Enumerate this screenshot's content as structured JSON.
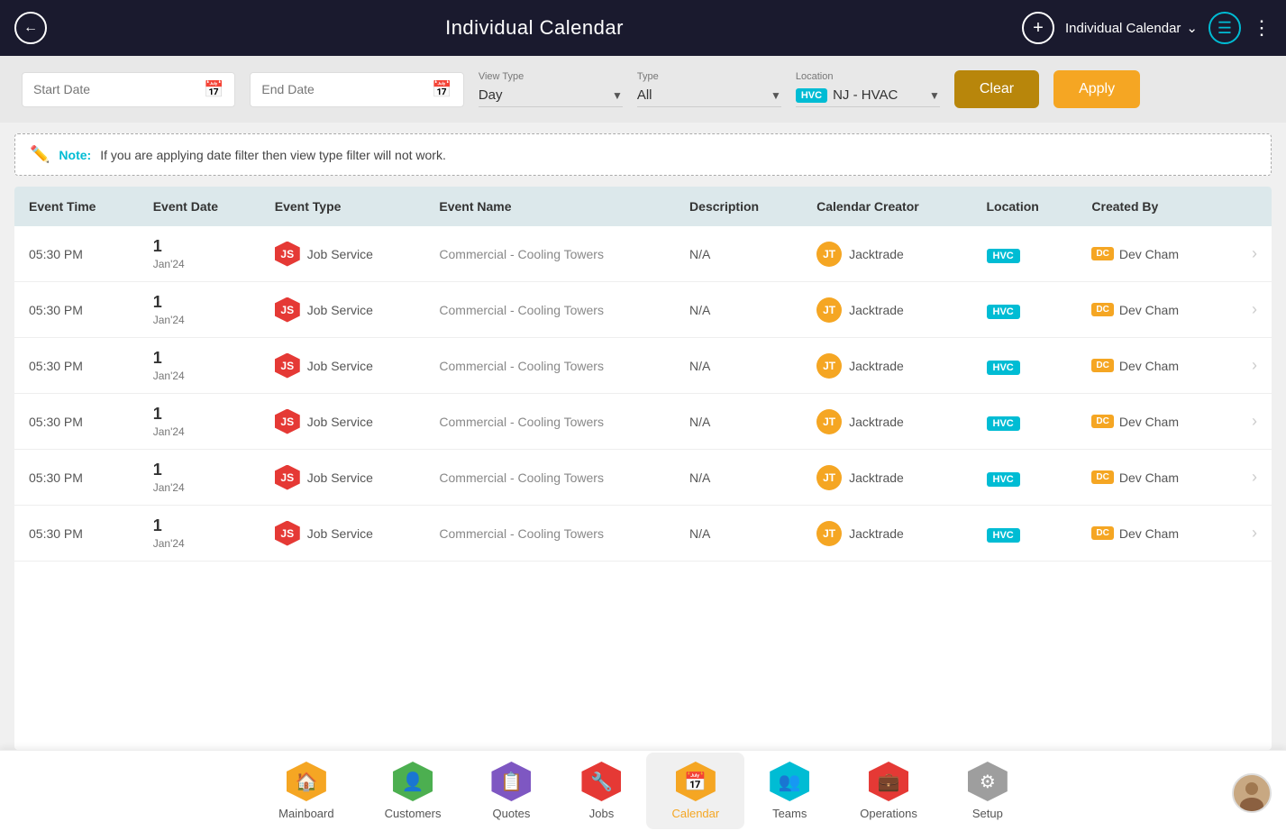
{
  "header": {
    "title": "Individual Calendar",
    "dropdown_label": "Individual Calendar",
    "back_icon": "←",
    "add_icon": "+",
    "menu_icon": "≡",
    "dots_icon": "⋮"
  },
  "filters": {
    "start_date_placeholder": "Start Date",
    "end_date_placeholder": "End Date",
    "view_type_label": "View Type",
    "view_type_value": "Day",
    "type_label": "Type",
    "type_value": "All",
    "location_label": "Location",
    "location_chip": "HVC",
    "location_value": "NJ - HVAC",
    "clear_label": "Clear",
    "apply_label": "Apply"
  },
  "note": {
    "label": "Note:",
    "text": "If you are applying date filter then view type filter will not work."
  },
  "table": {
    "columns": [
      "Event Time",
      "Event Date",
      "Event Type",
      "Event Name",
      "Description",
      "Calendar Creator",
      "Location",
      "Created By"
    ],
    "rows": [
      {
        "event_time": "05:30 PM",
        "event_date_num": "1",
        "event_date_month": "Jan'24",
        "event_type_badge": "JS",
        "event_type_label": "Job Service",
        "event_name": "Commercial - Cooling Towers",
        "description": "N/A",
        "creator_initials": "JT",
        "creator_name": "Jacktrade",
        "location_badge": "HVC",
        "created_by_badge": "DC",
        "created_by_name": "Dev Cham"
      },
      {
        "event_time": "05:30 PM",
        "event_date_num": "1",
        "event_date_month": "Jan'24",
        "event_type_badge": "JS",
        "event_type_label": "Job Service",
        "event_name": "Commercial - Cooling Towers",
        "description": "N/A",
        "creator_initials": "JT",
        "creator_name": "Jacktrade",
        "location_badge": "HVC",
        "created_by_badge": "DC",
        "created_by_name": "Dev Cham"
      },
      {
        "event_time": "05:30 PM",
        "event_date_num": "1",
        "event_date_month": "Jan'24",
        "event_type_badge": "JS",
        "event_type_label": "Job Service",
        "event_name": "Commercial - Cooling Towers",
        "description": "N/A",
        "creator_initials": "JT",
        "creator_name": "Jacktrade",
        "location_badge": "HVC",
        "created_by_badge": "DC",
        "created_by_name": "Dev Cham"
      },
      {
        "event_time": "05:30 PM",
        "event_date_num": "1",
        "event_date_month": "Jan'24",
        "event_type_badge": "JS",
        "event_type_label": "Job Service",
        "event_name": "Commercial - Cooling Towers",
        "description": "N/A",
        "creator_initials": "JT",
        "creator_name": "Jacktrade",
        "location_badge": "HVC",
        "created_by_badge": "DC",
        "created_by_name": "Dev Cham"
      },
      {
        "event_time": "05:30 PM",
        "event_date_num": "1",
        "event_date_month": "Jan'24",
        "event_type_badge": "JS",
        "event_type_label": "Job Service",
        "event_name": "Commercial - Cooling Towers",
        "description": "N/A",
        "creator_initials": "JT",
        "creator_name": "Jacktrade",
        "location_badge": "HVC",
        "created_by_badge": "DC",
        "created_by_name": "Dev Cham"
      },
      {
        "event_time": "05:30 PM",
        "event_date_num": "1",
        "event_date_month": "Jan'24",
        "event_type_badge": "JS",
        "event_type_label": "Job Service",
        "event_name": "Commercial - Cooling Towers",
        "description": "N/A",
        "creator_initials": "JT",
        "creator_name": "Jacktrade",
        "location_badge": "HVC",
        "created_by_badge": "DC",
        "created_by_name": "Dev Cham"
      }
    ]
  },
  "nav": {
    "items": [
      {
        "id": "mainboard",
        "label": "Mainboard",
        "icon": "🏠",
        "color": "#f5a623",
        "active": false
      },
      {
        "id": "customers",
        "label": "Customers",
        "icon": "👤",
        "color": "#4caf50",
        "active": false
      },
      {
        "id": "quotes",
        "label": "Quotes",
        "icon": "📋",
        "color": "#7e57c2",
        "active": false
      },
      {
        "id": "jobs",
        "label": "Jobs",
        "icon": "🔧",
        "color": "#e53935",
        "active": false
      },
      {
        "id": "calendar",
        "label": "Calendar",
        "icon": "📅",
        "color": "#f5a623",
        "active": true
      },
      {
        "id": "teams",
        "label": "Teams",
        "icon": "👥",
        "color": "#00bcd4",
        "active": false
      },
      {
        "id": "operations",
        "label": "Operations",
        "icon": "💼",
        "color": "#e53935",
        "active": false
      },
      {
        "id": "setup",
        "label": "Setup",
        "icon": "⚙",
        "color": "#9e9e9e",
        "active": false
      }
    ]
  }
}
